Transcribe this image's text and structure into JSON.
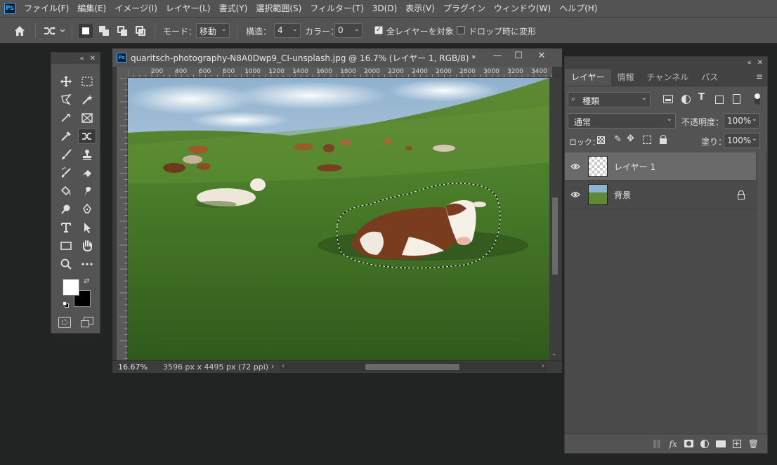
{
  "app": {
    "logo": "Ps"
  },
  "menubar": {
    "items": [
      "ファイル(F)",
      "編集(E)",
      "イメージ(I)",
      "レイヤー(L)",
      "書式(Y)",
      "選択範囲(S)",
      "フィルター(T)",
      "3D(D)",
      "表示(V)",
      "プラグイン",
      "ウィンドウ(W)",
      "ヘルプ(H)"
    ]
  },
  "options": {
    "mode_label": "モード：",
    "mode_value": "移動",
    "structure_label": "構造：",
    "structure_value": "4",
    "color_label": "カラー：",
    "color_value": "0",
    "sample_all_layers": {
      "label": "全レイヤーを対象",
      "checked": true
    },
    "transform_on_drop": {
      "label": "ドロップ時に変形",
      "checked": false
    }
  },
  "document": {
    "title": "quaritsch-photography-N8A0Dwp9_CI-unsplash.jpg @ 16.7% (レイヤー 1, RGB/8) *",
    "ruler_ticks": [
      "200",
      "400",
      "600",
      "800",
      "1000",
      "1200",
      "1400",
      "1600",
      "1800",
      "2000",
      "2200",
      "2400",
      "2600",
      "2800",
      "3000",
      "3200",
      "3400"
    ],
    "zoom": "16.67%",
    "dimensions": "3596 px x 4495 px (72 ppi)"
  },
  "panel": {
    "tabs": [
      "レイヤー",
      "情報",
      "チャンネル",
      "パス"
    ],
    "filter_kind": "種類",
    "blend_mode": "通常",
    "opacity_label": "不透明度：",
    "opacity_value": "100%",
    "lock_label": "ロック：",
    "fill_label": "塗り：",
    "fill_value": "100%",
    "layers": [
      {
        "name": "レイヤー 1",
        "selected": true,
        "locked": false
      },
      {
        "name": "背景",
        "selected": false,
        "locked": true
      }
    ]
  },
  "colors": {
    "accent": "#31a8ff",
    "chrome": "#535353",
    "background": "#222323"
  },
  "toolbox": {
    "foreground": "#ffffff",
    "background": "#000000"
  }
}
